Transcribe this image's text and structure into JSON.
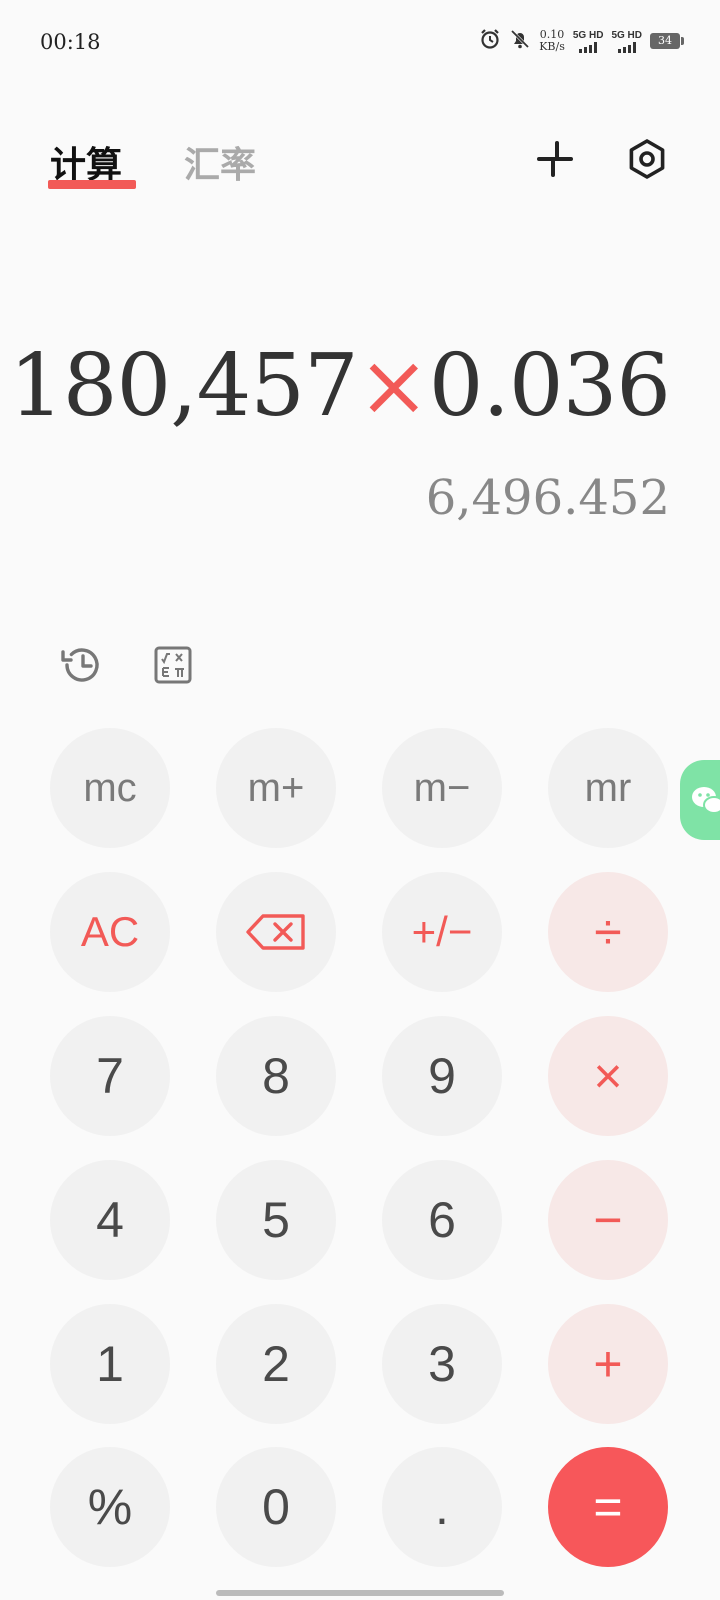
{
  "status": {
    "time": "00:18",
    "net_speed_value": "0.10",
    "net_speed_unit": "KB/s",
    "sim1": "5G HD",
    "sim2": "5G HD",
    "battery": "34"
  },
  "tabs": {
    "calculator": "计算",
    "exchange": "汇率"
  },
  "display": {
    "operand1": "180,457",
    "operator": "×",
    "operand2": "0.036",
    "result": "6,496.452"
  },
  "keys": {
    "mc": "mc",
    "mplus": "m+",
    "mminus": "m−",
    "mr": "mr",
    "ac": "AC",
    "plusminus": "+/−",
    "divide": "÷",
    "k7": "7",
    "k8": "8",
    "k9": "9",
    "multiply": "×",
    "k4": "4",
    "k5": "5",
    "k6": "6",
    "minus": "−",
    "k1": "1",
    "k2": "2",
    "k3": "3",
    "plus": "+",
    "percent": "%",
    "k0": "0",
    "dot": ".",
    "equals": "="
  },
  "colors": {
    "accent": "#f25a57",
    "operator_bg": "#f7e8e7",
    "key_bg": "#f1f1f1"
  }
}
